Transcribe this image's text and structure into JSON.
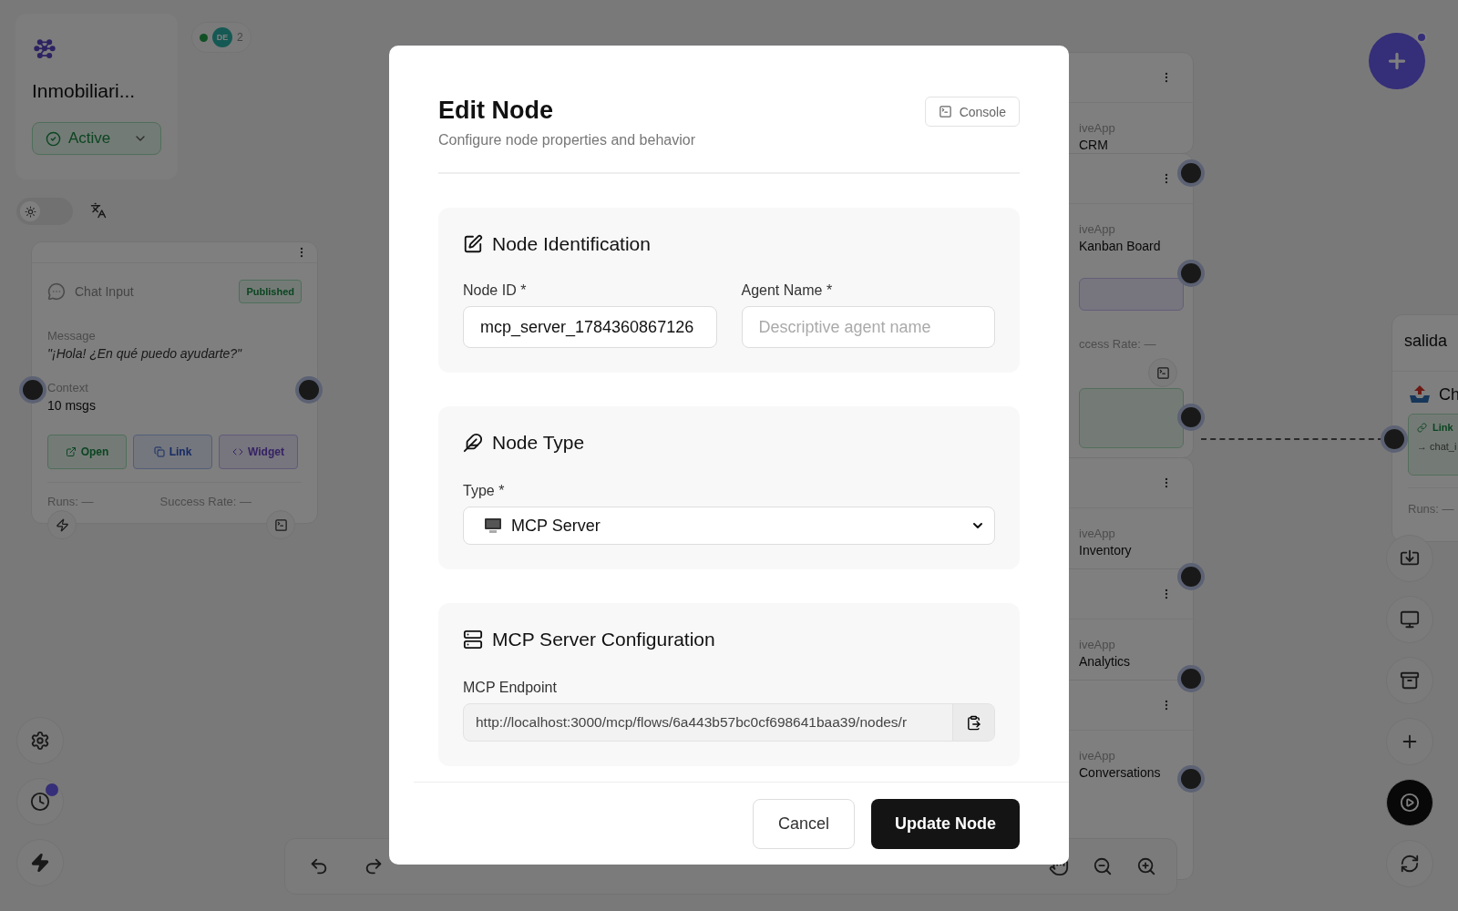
{
  "workspace": {
    "name": "Inmobiliari...",
    "status": "Active"
  },
  "presence": {
    "initials": "DE",
    "count": "2"
  },
  "theme_toggle": {
    "on": false
  },
  "chat_node": {
    "title": "Chat Input",
    "badge": "Published",
    "message_label": "Message",
    "message": "\"¡Hola! ¿En qué puedo ayudarte?\"",
    "context_label": "Context",
    "context": "10 msgs",
    "actions": [
      "Open",
      "Link",
      "Widget"
    ],
    "runs": "Runs: —",
    "success_rate": "Success Rate: —"
  },
  "stacked_nodes": [
    {
      "type_label": "iveApp",
      "name": "CRM"
    },
    {
      "type_label": "iveApp",
      "name": "Kanban Board",
      "stats": "ccess Rate: —"
    },
    {
      "type_label": "iveApp",
      "name": "Inventory"
    },
    {
      "type_label": "iveApp",
      "name": "Analytics"
    },
    {
      "type_label": "iveApp",
      "name": "Conversations"
    }
  ],
  "output_node": {
    "title": "salida",
    "item": "Ch",
    "link": "Link",
    "target": "→ chat_i",
    "runs": "Runs: —"
  },
  "modal": {
    "title": "Edit Node",
    "subtitle": "Configure node properties and behavior",
    "console_button": "Console",
    "identification": {
      "title": "Node Identification",
      "fields": [
        {
          "label": "Node ID *",
          "value": "mcp_server_1784360867126"
        },
        {
          "label": "Agent Name *",
          "placeholder": "Descriptive agent name"
        }
      ]
    },
    "node_type": {
      "title": "Node Type",
      "label": "Type *",
      "value": "MCP Server"
    },
    "mcp_config": {
      "title": "MCP Server Configuration",
      "label": "MCP Endpoint",
      "value": "http://localhost:3000/mcp/flows/6a443b57bc0cf698641baa39/nodes/r"
    },
    "buttons": {
      "cancel": "Cancel",
      "submit": "Update Node"
    }
  }
}
